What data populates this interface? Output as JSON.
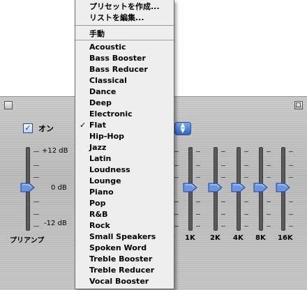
{
  "equalizer": {
    "on_label": "オン",
    "on_checked": true,
    "preamp_label": "プリアンプ",
    "db_top": "+12 dB",
    "db_mid": "0 dB",
    "db_bottom": "-12 dB",
    "bands": [
      "1K",
      "2K",
      "4K",
      "8K",
      "16K"
    ]
  },
  "menu": {
    "top_items": [
      "プリセットを作成...",
      "リストを編集..."
    ],
    "manual": "手動",
    "presets": [
      "Acoustic",
      "Bass Booster",
      "Bass Reducer",
      "Classical",
      "Dance",
      "Deep",
      "Electronic",
      "Flat",
      "Hip-Hop",
      "Jazz",
      "Latin",
      "Loudness",
      "Lounge",
      "Piano",
      "Pop",
      "R&B",
      "Rock",
      "Small Speakers",
      "Spoken Word",
      "Treble Booster",
      "Treble Reducer",
      "Vocal Booster"
    ],
    "selected": "Flat",
    "check_mark": "✓"
  },
  "icons": {
    "popup_arrows": "up-down-arrows-icon",
    "check": "checkmark-icon"
  },
  "colors": {
    "accent": "#2f65c4",
    "slider_thumb": "#5b86d8"
  }
}
